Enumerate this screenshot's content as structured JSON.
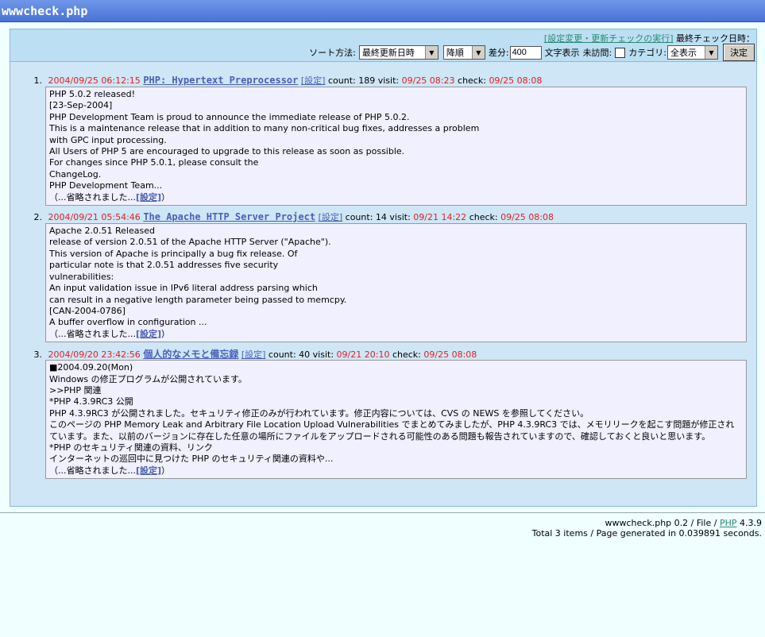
{
  "app_title": "wwwcheck.php",
  "controls": {
    "run_link": "[設定変更・更新チェックの実行]",
    "last_check_label": "最終チェック日時：",
    "sort_label": "ソート方法:",
    "sort_value": "最終更新日時",
    "order_value": "降順",
    "diff_label": "差分:",
    "diff_value": "400",
    "text_display_label": "文字表示",
    "unvisited_label": "未訪問:",
    "category_label": "カテゴリ:",
    "category_value": "全表示",
    "submit_label": "決定"
  },
  "items": [
    {
      "num": "1.",
      "date": "2004/09/25 06:12:15",
      "title": "PHP: Hypertext Preprocessor",
      "settings_label": "[設定]",
      "count_label": "count:",
      "count": "189",
      "visit_label": "visit:",
      "visit": "09/25 08:23",
      "check_label": "check:",
      "check": "09/25 08:08",
      "lines": [
        "PHP 5.0.2 released!",
        "[23-Sep-2004]",
        "PHP Development Team is proud to announce the immediate release of PHP 5.0.2.",
        "This is a maintenance release that in addition to many non-critical bug fixes, addresses a problem",
        "with GPC input processing.",
        "All Users of PHP 5 are encouraged to upgrade to this release as soon as possible.",
        "For changes since PHP 5.0.1, please consult the",
        "ChangeLog.",
        "PHP Development Team..."
      ],
      "omit_prefix": "（...省略されました...",
      "omit_link": "[設定]",
      "omit_suffix": "）"
    },
    {
      "num": "2.",
      "date": "2004/09/21 05:54:46",
      "title": "The Apache HTTP Server Project",
      "settings_label": "[設定]",
      "count_label": "count:",
      "count": "14",
      "visit_label": "visit:",
      "visit": "09/21 14:22",
      "check_label": "check:",
      "check": "09/25 08:08",
      "lines": [
        "Apache 2.0.51 Released",
        "release of version 2.0.51 of the Apache HTTP Server (\"Apache\").",
        "This version of Apache is principally a bug fix release. Of",
        "particular note is that 2.0.51 addresses five security",
        "vulnerabilities:",
        "An input validation issue in IPv6 literal address parsing which",
        "can result in a negative length parameter being passed to memcpy.",
        "[CAN-2004-0786]",
        "A buffer overflow in configuration ..."
      ],
      "omit_prefix": "（...省略されました...",
      "omit_link": "[設定]",
      "omit_suffix": "）"
    },
    {
      "num": "3.",
      "date": "2004/09/20 23:42:56",
      "title": "個人的なメモと備忘録",
      "settings_label": "[設定]",
      "count_label": "count:",
      "count": "40",
      "visit_label": "visit:",
      "visit": "09/21 20:10",
      "check_label": "check:",
      "check": "09/25 08:08",
      "lines": [
        "■2004.09.20(Mon)",
        "Windows の修正プログラムが公開されています。",
        ">>PHP 関連",
        "*PHP 4.3.9RC3 公開",
        "PHP 4.3.9RC3 が公開されました。セキュリティ修正のみが行われています。修正内容については、CVS の NEWS を参照してください。",
        "このページの PHP Memory Leak and Arbitrary File Location Upload Vulnerabilities でまとめてみましたが、PHP 4.3.9RC3 では、メモリリークを起こす問題が修正されています。また、以前のバージョンに存在した任意の場所にファイルをアップロードされる可能性のある問題も報告されていますので、確認しておくと良いと思います。",
        "*PHP のセキュリティ関連の資料、リンク",
        "インターネットの巡回中に見つけた PHP のセキュリティ関連の資料や..."
      ],
      "omit_prefix": "（...省略されました...",
      "omit_link": "[設定]",
      "omit_suffix": "）"
    }
  ],
  "footer": {
    "line1_prefix": "wwwcheck.php 0.2 / File / ",
    "line1_link": "PHP",
    "line1_suffix": " 4.3.9",
    "line2": "Total 3 items / Page generated in 0.039891 seconds."
  }
}
